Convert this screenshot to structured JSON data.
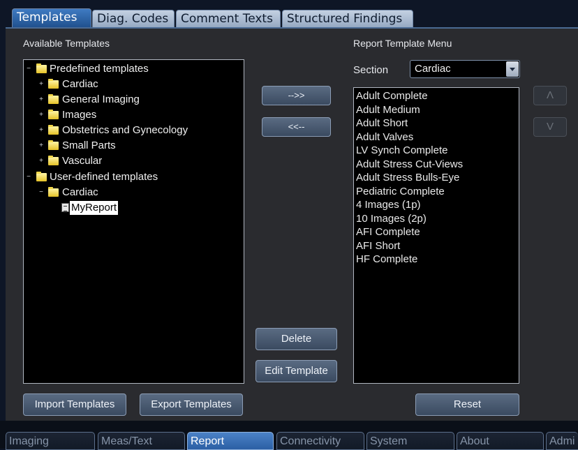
{
  "top_tabs": [
    {
      "label": "Templates"
    },
    {
      "label": "Diag. Codes"
    },
    {
      "label": "Comment Texts"
    },
    {
      "label": "Structured Findings"
    }
  ],
  "left": {
    "heading": "Available Templates",
    "tree": {
      "predefined": "Predefined templates",
      "cardiac": "Cardiac",
      "general_imaging": "General Imaging",
      "images": "Images",
      "obgyn": "Obstetrics and Gynecology",
      "small_parts": "Small Parts",
      "vascular": "Vascular",
      "user_defined": "User-defined templates",
      "user_cardiac": "Cardiac",
      "my_report": "MyReport"
    }
  },
  "middle": {
    "add": "-->>",
    "remove": "<<--",
    "delete": "Delete",
    "edit_template": "Edit Template"
  },
  "right": {
    "heading": "Report Template Menu",
    "section_label": "Section",
    "section_value": "Cardiac",
    "items": [
      "Adult Complete",
      "Adult Medium",
      "Adult Short",
      "Adult Valves",
      "LV Synch Complete",
      "Adult Stress Cut-Views",
      "Adult Stress Bulls-Eye",
      "Pediatric Complete",
      "4 Images (1p)",
      "10 Images (2p)",
      "AFI Complete",
      "AFI Short",
      "HF Complete"
    ],
    "move_up": "Λ",
    "move_down": "V"
  },
  "bottom_buttons": {
    "import": "Import Templates",
    "export": "Export Templates",
    "reset": "Reset"
  },
  "bottom_tabs": [
    {
      "label": "Imaging"
    },
    {
      "label": "Meas/Text"
    },
    {
      "label": "Report"
    },
    {
      "label": "Connectivity"
    },
    {
      "label": "System"
    },
    {
      "label": "About"
    },
    {
      "label": "Admi"
    }
  ]
}
